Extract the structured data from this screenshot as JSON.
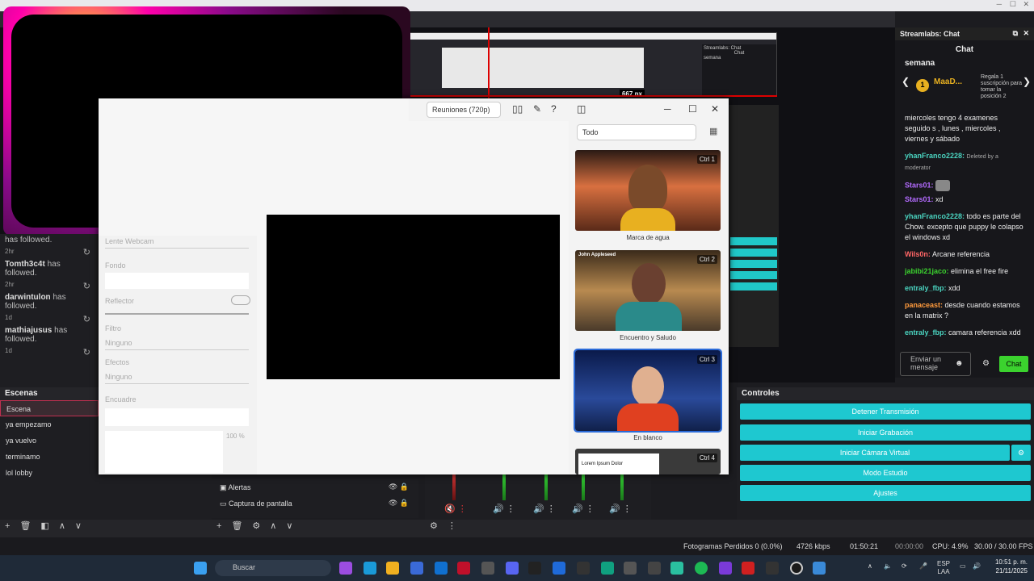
{
  "colors": {
    "accent": "#1ec8d0",
    "chat_green": "#3bd22e",
    "status_live": "#d00000",
    "mod_pink": "#c03050"
  },
  "activity": {
    "items": [
      {
        "name": "",
        "text": "has followed.",
        "time": "2hr"
      },
      {
        "name": "Tomth3c4t",
        "text": "has followed.",
        "time": "2hr"
      },
      {
        "name": "darwintulon",
        "text": "has followed.",
        "time": "1d"
      },
      {
        "name": "mathiajusus",
        "text": "has followed.",
        "time": "1d"
      }
    ]
  },
  "scenes": {
    "title": "Escenas",
    "items": [
      "Escena",
      "ya empezamo",
      "ya vuelvo",
      "terminamo",
      "lol lobby"
    ]
  },
  "sources": {
    "items": [
      "Alertas",
      "Captura de pantalla"
    ]
  },
  "nested": {
    "px": "667 px",
    "chat_title": "Streamlabs: Chat",
    "chat": "Chat",
    "semana": "semana"
  },
  "dialog": {
    "resolution": "Reuniones (720p)",
    "filter": "Todo",
    "left": {
      "cam": "Lente Webcam",
      "fondo": "Fondo",
      "reflector": "Reflector",
      "filtro": "Filtro",
      "filtro_val": "Ninguno",
      "efectos": "Efectos",
      "efectos_val": "Ninguno",
      "encuadre": "Encuadre",
      "zoom": "100 %"
    },
    "cards": [
      {
        "key": "Ctrl",
        "num": "1",
        "caption": "Marca de agua"
      },
      {
        "key": "Ctrl",
        "num": "2",
        "caption": "Encuentro y Saludo",
        "overlay": "John Appleseed"
      },
      {
        "key": "Ctrl",
        "num": "3",
        "caption": "En blanco"
      },
      {
        "key": "Ctrl",
        "num": "4",
        "caption": "",
        "overlay": "Lorem Ipsum Dolor"
      }
    ]
  },
  "chat": {
    "title": "Streamlabs: Chat",
    "subtitle": "Chat",
    "semana": "semana",
    "top_user": "MaaD...",
    "top_rank": "1",
    "gift_text": "Regala 1 suscripción para tomar la posición 2",
    "messages": [
      {
        "user": "",
        "text": "miercoles tengo 4 examenes seguido s , lunes , miercoles , viernes y sábado",
        "color": "#eeeeee"
      },
      {
        "user": "yhanFranco2228:",
        "text": "Deleted by a moderator",
        "color": "#4ad4c0"
      },
      {
        "user": "Stars01:",
        "text": "",
        "color": "#b36bff"
      },
      {
        "user": "Stars01:",
        "text": "xd",
        "color": "#b36bff"
      },
      {
        "user": "yhanFranco2228:",
        "text": "todo es parte del Chow. excepto que puppy le colapso el windows xd",
        "color": "#4ad4c0"
      },
      {
        "user": "Wils0n:",
        "text": "Arcane referencia",
        "color": "#ff6666"
      },
      {
        "user": "jabibi21jaco:",
        "text": "elimina el free fire",
        "color": "#3bd22e"
      },
      {
        "user": "entraly_fbp:",
        "text": "xdd",
        "color": "#4ad4c0"
      },
      {
        "user": "panaceast:",
        "text": "desde cuando estamos en la matrix ?",
        "color": "#ff9a3c"
      },
      {
        "user": "entraly_fbp:",
        "text": "camara referencia xdd",
        "color": "#4ad4c0"
      }
    ],
    "input_placeholder": "Enviar un mensaje",
    "send": "Chat"
  },
  "controls": {
    "title": "Controles",
    "buttons": [
      "Detener Transmisión",
      "Iniciar Grabación",
      "Iniciar Cámara Virtual",
      "Modo Estudio",
      "Ajustes"
    ]
  },
  "status": {
    "dropped": "Fotogramas Perdidos 0 (0.0%)",
    "bitrate": "4726 kbps",
    "live_time": "01:50:21",
    "rec_time": "00:00:00",
    "cpu": "CPU: 4.9%",
    "fps": "30.00 / 30.00 FPS"
  },
  "taskbar": {
    "search": "Buscar",
    "lang": "ESP",
    "lang2": "LAA",
    "time": "10:51 p. m.",
    "date": "21/11/2025"
  }
}
